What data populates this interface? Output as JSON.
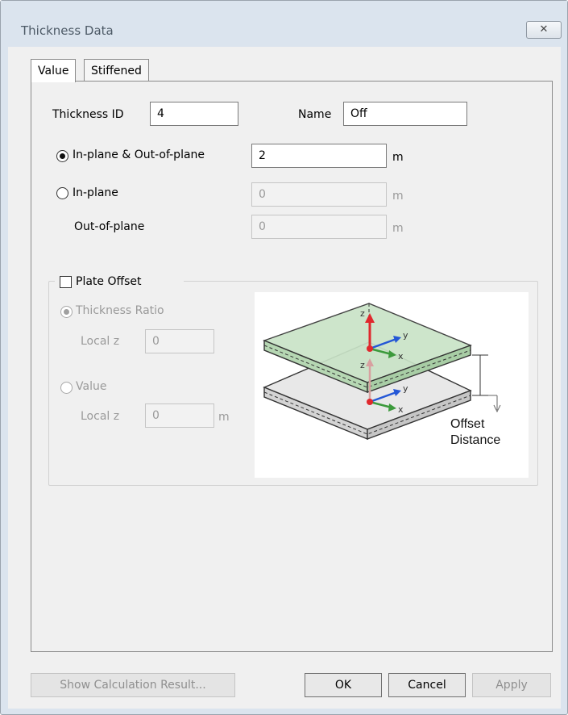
{
  "window": {
    "title": "Thickness Data",
    "close_symbol": "✕"
  },
  "tabs": [
    {
      "label": "Value",
      "active": true
    },
    {
      "label": "Stiffened",
      "active": false
    }
  ],
  "form": {
    "thickness_id_label": "Thickness ID",
    "thickness_id_value": "4",
    "name_label": "Name",
    "name_value": "Off",
    "inplane_outplane_label": "In-plane & Out-of-plane",
    "inplane_outplane_value": "2",
    "inplane_outplane_unit": "m",
    "inplane_label": "In-plane",
    "inplane_value": "0",
    "inplane_unit": "m",
    "outplane_label": "Out-of-plane",
    "outplane_value": "0",
    "outplane_unit": "m",
    "selected_mode": "In-plane & Out-of-plane"
  },
  "plate_offset": {
    "label": "Plate Offset",
    "checked": false,
    "thickness_ratio_label": "Thickness Ratio",
    "ratio_local_z_label": "Local z",
    "ratio_local_z_value": "0",
    "value_label": "Value",
    "value_local_z_label": "Local z",
    "value_local_z_value": "0",
    "value_unit": "m",
    "selected": "Thickness Ratio"
  },
  "diagram": {
    "offset_label_line1": "Offset",
    "offset_label_line2": "Distance",
    "axis_y": "y",
    "axis_x": "x",
    "axis_z": "z",
    "colors": {
      "plate_top": "#c9e3c7",
      "plate_bottom": "#e6e6e6",
      "axis_z": "#e0282d",
      "axis_y": "#2457d6",
      "axis_x": "#3c9a3c"
    }
  },
  "buttons": {
    "show_calc": "Show Calculation Result...",
    "ok": "OK",
    "cancel": "Cancel",
    "apply": "Apply"
  }
}
